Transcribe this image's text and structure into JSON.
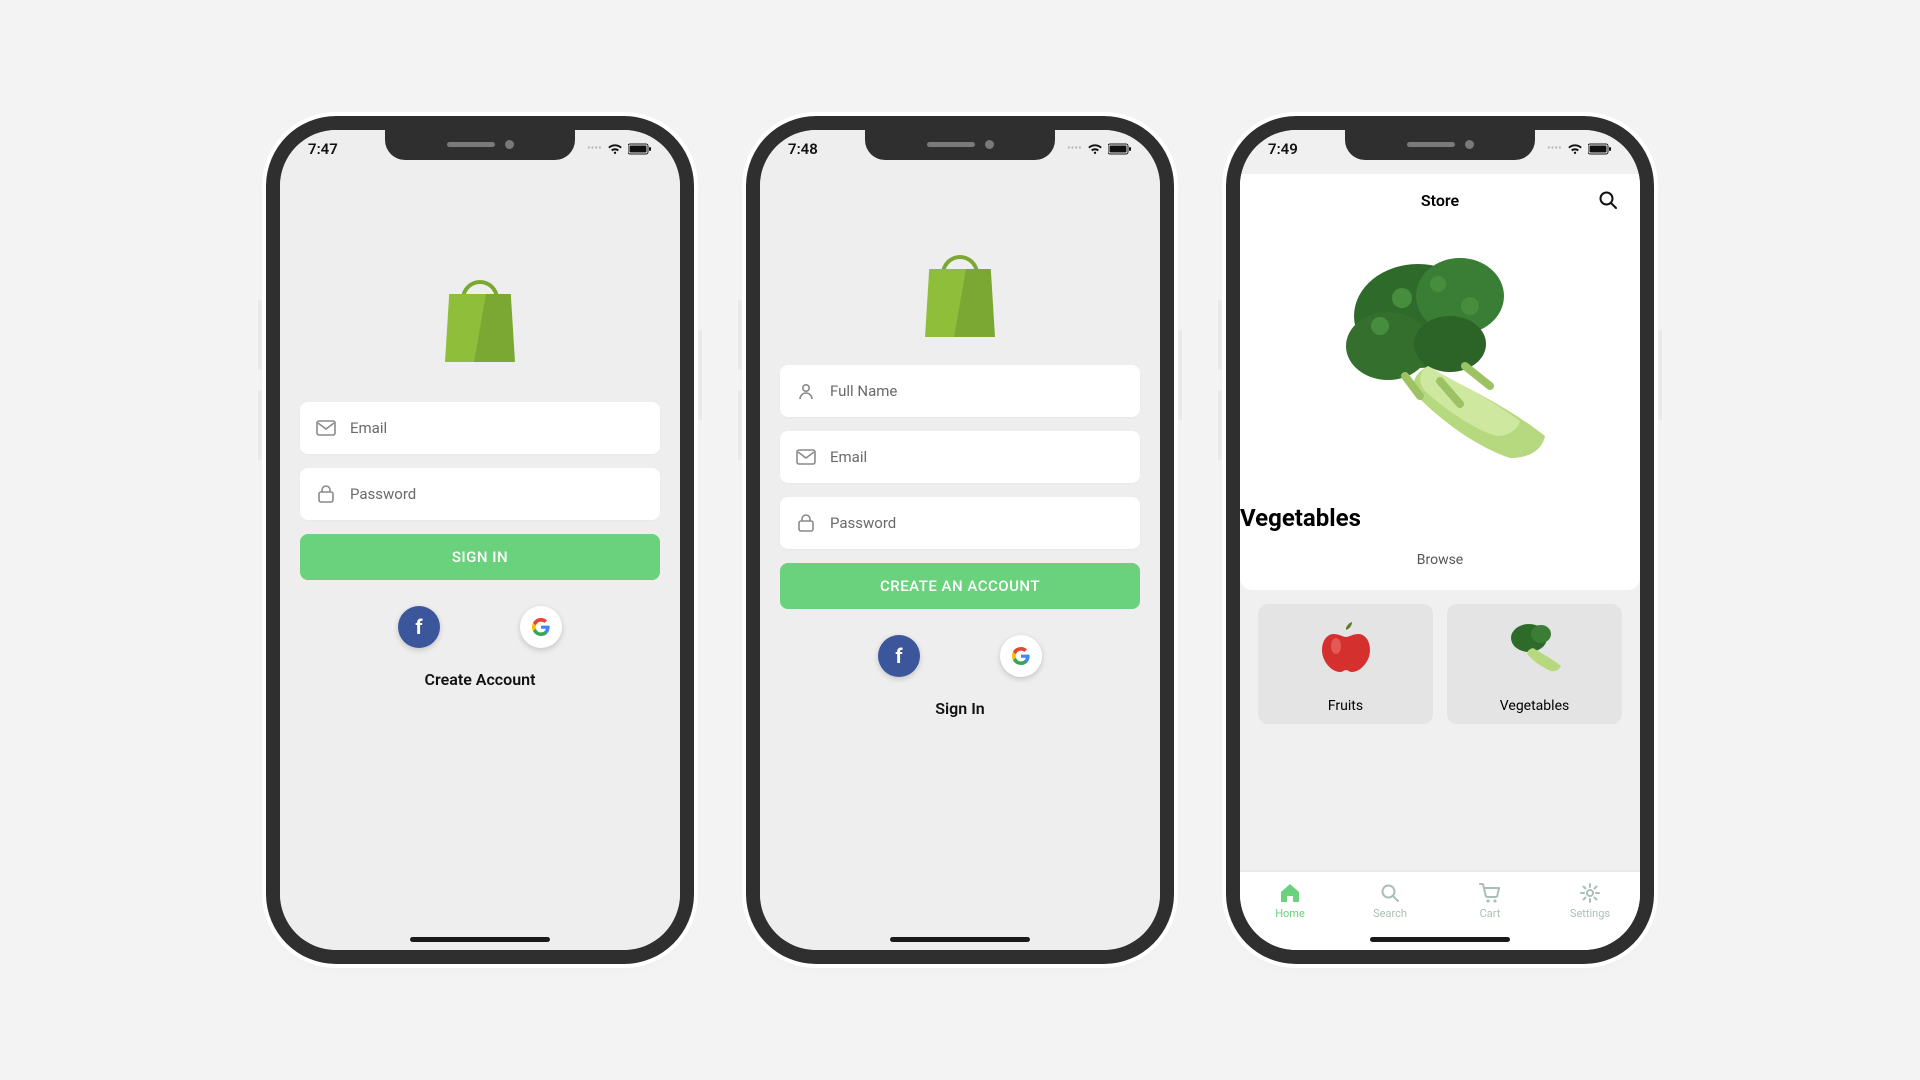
{
  "colors": {
    "accent": "#6ad27d",
    "fb": "#3b569b",
    "bag": "#8fbf3a"
  },
  "screens": [
    {
      "time": "7:47",
      "fields": [
        {
          "icon": "mail",
          "placeholder": "Email"
        },
        {
          "icon": "lock",
          "placeholder": "Password"
        }
      ],
      "primary_button": "SIGN IN",
      "alt_link": "Create Account"
    },
    {
      "time": "7:48",
      "fields": [
        {
          "icon": "person",
          "placeholder": "Full Name"
        },
        {
          "icon": "mail",
          "placeholder": "Email"
        },
        {
          "icon": "lock",
          "placeholder": "Password"
        }
      ],
      "primary_button": "CREATE AN ACCOUNT",
      "alt_link": "Sign In"
    },
    {
      "time": "7:49",
      "topbar_title": "Store",
      "hero_title": "Vegetables",
      "browse_label": "Browse",
      "categories": [
        {
          "label": "Fruits",
          "image": "apple"
        },
        {
          "label": "Vegetables",
          "image": "broccoli"
        }
      ],
      "nav": [
        {
          "label": "Home",
          "icon": "home",
          "active": true
        },
        {
          "label": "Search",
          "icon": "search",
          "active": false
        },
        {
          "label": "Cart",
          "icon": "cart",
          "active": false
        },
        {
          "label": "Settings",
          "icon": "gear",
          "active": false
        }
      ]
    }
  ]
}
